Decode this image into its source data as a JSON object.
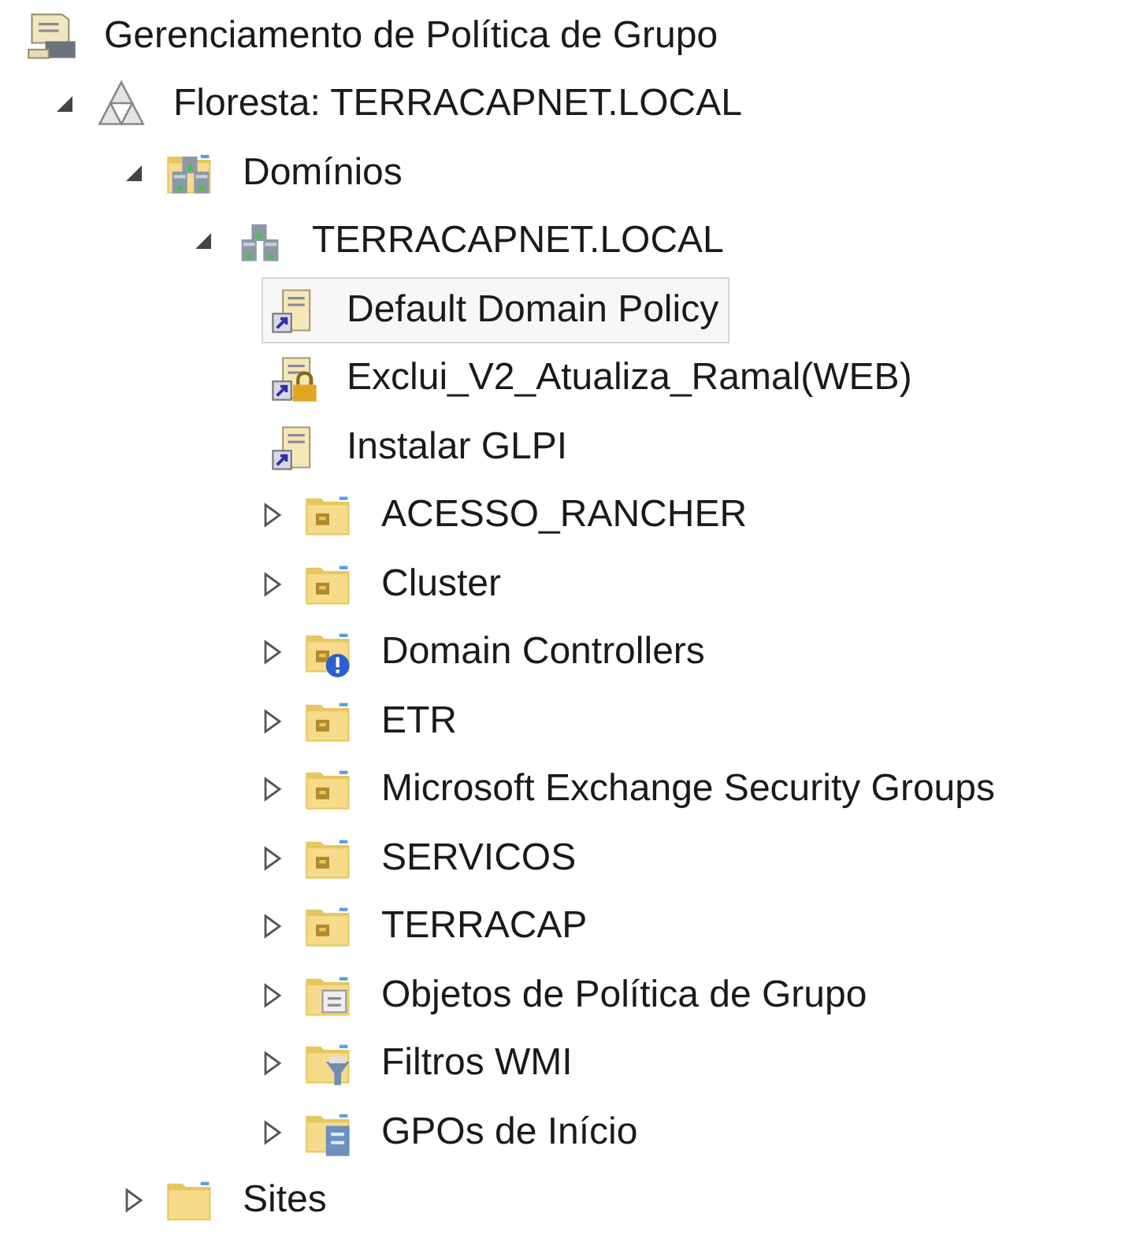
{
  "tree": {
    "label": "Gerenciamento de Política de Grupo",
    "kind": "console",
    "selected": false,
    "children": [
      {
        "label": "Floresta: TERRACAPNET.LOCAL",
        "kind": "forest",
        "selected": false,
        "expanded": true,
        "children": [
          {
            "label": "Domínios",
            "kind": "domains",
            "selected": false,
            "expanded": true,
            "children": [
              {
                "label": "TERRACAPNET.LOCAL",
                "kind": "domain",
                "selected": false,
                "expanded": true,
                "children": [
                  {
                    "label": "Default Domain Policy",
                    "kind": "gpo",
                    "selected": true
                  },
                  {
                    "label": "Exclui_V2_Atualiza_Ramal(WEB)",
                    "kind": "gpo-locked",
                    "selected": false
                  },
                  {
                    "label": "Instalar GLPI",
                    "kind": "gpo",
                    "selected": false
                  },
                  {
                    "label": "ACESSO_RANCHER",
                    "kind": "ou",
                    "selected": false,
                    "expanded": false
                  },
                  {
                    "label": "Cluster",
                    "kind": "ou",
                    "selected": false,
                    "expanded": false
                  },
                  {
                    "label": "Domain Controllers",
                    "kind": "ou-warning",
                    "selected": false,
                    "expanded": false
                  },
                  {
                    "label": "ETR",
                    "kind": "ou",
                    "selected": false,
                    "expanded": false
                  },
                  {
                    "label": "Microsoft Exchange Security Groups",
                    "kind": "ou",
                    "selected": false,
                    "expanded": false
                  },
                  {
                    "label": "SERVICOS",
                    "kind": "ou",
                    "selected": false,
                    "expanded": false
                  },
                  {
                    "label": "TERRACAP",
                    "kind": "ou",
                    "selected": false,
                    "expanded": false
                  },
                  {
                    "label": "Objetos de Política de Grupo",
                    "kind": "gpo-folder",
                    "selected": false,
                    "expanded": false
                  },
                  {
                    "label": "Filtros WMI",
                    "kind": "wmi-folder",
                    "selected": false,
                    "expanded": false
                  },
                  {
                    "label": "GPOs de Início",
                    "kind": "starter-folder",
                    "selected": false,
                    "expanded": false
                  }
                ]
              }
            ]
          },
          {
            "label": "Sites",
            "kind": "folder",
            "selected": false,
            "expanded": false
          }
        ]
      }
    ]
  }
}
